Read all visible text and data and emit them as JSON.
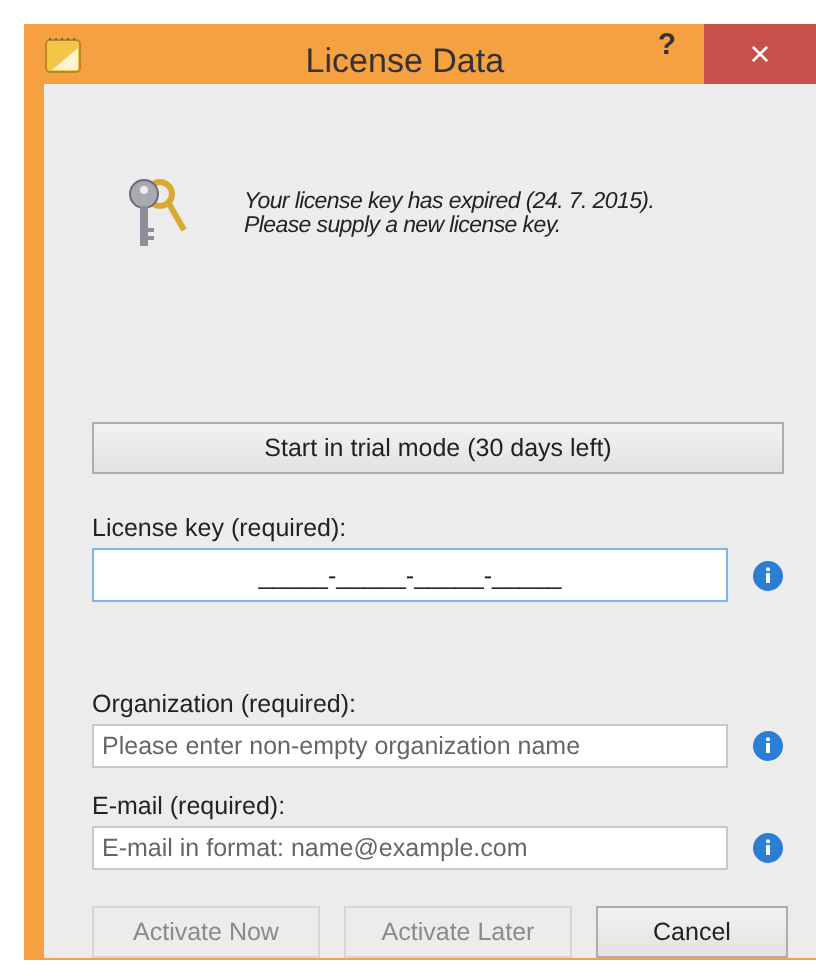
{
  "window": {
    "title": "License Data",
    "help": "?",
    "close": "×"
  },
  "message": {
    "lines": [
      "Your license key has expired (24. 7. 2015).",
      "Please supply a new license key."
    ]
  },
  "trial_button": {
    "label": "Start in trial mode (30 days left)"
  },
  "fields": [
    {
      "label": "License key (required):",
      "value": "_____-_____-_____-_____",
      "focused": true
    },
    {
      "label": "Organization (required):",
      "placeholder": "Please enter non-empty organization name",
      "focused": false
    },
    {
      "label": "E-mail (required):",
      "placeholder": "E-mail in format: name@example.com",
      "focused": false
    }
  ],
  "buttons": [
    {
      "label": "Activate Now",
      "disabled": true
    },
    {
      "label": "Activate Later",
      "disabled": true
    },
    {
      "label": "Cancel",
      "disabled": false
    }
  ]
}
